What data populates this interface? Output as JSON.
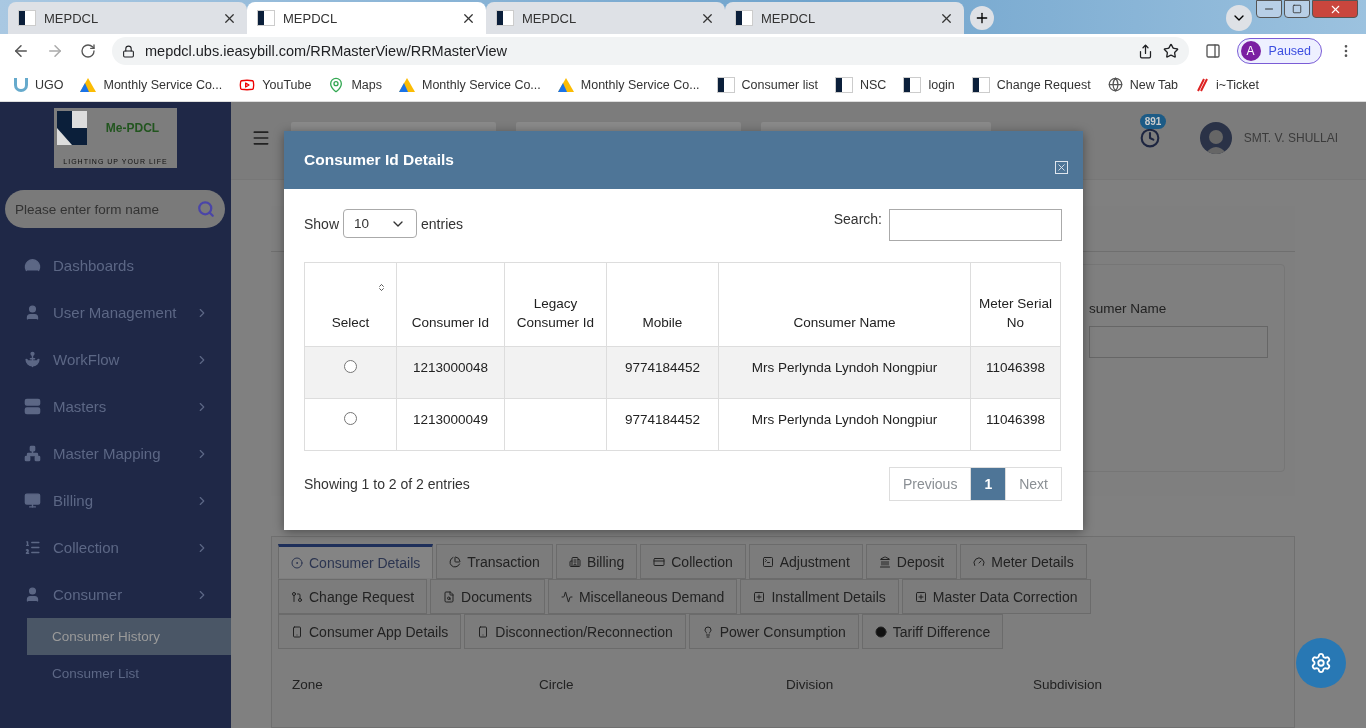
{
  "browser": {
    "tabs": [
      {
        "title": "MEPDCL",
        "selected": false
      },
      {
        "title": "MEPDCL",
        "selected": true
      },
      {
        "title": "MEPDCL",
        "selected": false
      },
      {
        "title": "MEPDCL",
        "selected": false
      }
    ],
    "address": "mepdcl.ubs.ieasybill.com/RRMasterView/RRMasterView",
    "profile": {
      "initial": "A",
      "status": "Paused"
    },
    "bookmarks": [
      "UGO",
      "Monthly Service Co...",
      "YouTube",
      "Maps",
      "Monthly Service Co...",
      "Monthly Service Co...",
      "Consumer list",
      "NSC",
      "login",
      "Change Request",
      "New Tab",
      "i~Ticket"
    ]
  },
  "sidebar": {
    "logo": {
      "name": "Me-PDCL",
      "tagline": "LIGHTING UP YOUR LIFE"
    },
    "search": {
      "placeholder": "Please enter form name"
    },
    "items": [
      {
        "label": "Dashboards",
        "has_submenu": false,
        "expanded": false
      },
      {
        "label": "User Management",
        "has_submenu": true,
        "expanded": false
      },
      {
        "label": "WorkFlow",
        "has_submenu": true,
        "expanded": false
      },
      {
        "label": "Masters",
        "has_submenu": true,
        "expanded": false
      },
      {
        "label": "Master Mapping",
        "has_submenu": true,
        "expanded": false
      },
      {
        "label": "Billing",
        "has_submenu": true,
        "expanded": false
      },
      {
        "label": "Collection",
        "has_submenu": true,
        "expanded": false
      },
      {
        "label": "Consumer",
        "has_submenu": true,
        "expanded": true,
        "children": [
          {
            "label": "Consumer History",
            "selected": true
          },
          {
            "label": "Consumer List",
            "selected": false
          }
        ]
      }
    ]
  },
  "header": {
    "notification_count": "891",
    "user": "SMT. V. SHULLAI"
  },
  "form": {
    "visible_label": "sumer Name"
  },
  "detail_tabs": [
    {
      "label": "Consumer Details",
      "selected": true
    },
    {
      "label": "Transaction",
      "selected": false
    },
    {
      "label": "Billing",
      "selected": false
    },
    {
      "label": "Collection",
      "selected": false
    },
    {
      "label": "Adjustment",
      "selected": false
    },
    {
      "label": "Deposit",
      "selected": false
    },
    {
      "label": "Meter Details",
      "selected": false
    },
    {
      "label": "Change Request",
      "selected": false
    },
    {
      "label": "Documents",
      "selected": false
    },
    {
      "label": "Miscellaneous Demand",
      "selected": false
    },
    {
      "label": "Installment Details",
      "selected": false
    },
    {
      "label": "Master Data Correction",
      "selected": false
    },
    {
      "label": "Consumer App Details",
      "selected": false
    },
    {
      "label": "Disconnection/Reconnection",
      "selected": false
    },
    {
      "label": "Power Consumption",
      "selected": false
    },
    {
      "label": "Tariff Difference",
      "selected": false
    }
  ],
  "detail_fields": [
    "Zone",
    "Circle",
    "Division",
    "Subdivision"
  ],
  "modal": {
    "title": "Consumer Id Details",
    "show_label": "Show",
    "page_size": "10",
    "entries_label": "entries",
    "search_label": "Search:",
    "table": {
      "columns": [
        "Select",
        "Consumer Id",
        "Legacy Consumer Id",
        "Mobile",
        "Consumer Name",
        "Meter Serial No"
      ],
      "rows": [
        {
          "selected": false,
          "consumer_id": "1213000048",
          "legacy_id": "",
          "mobile": "9774184452",
          "name": "Mrs Perlynda Lyndoh Nongpiur",
          "meter": "11046398"
        },
        {
          "selected": false,
          "consumer_id": "1213000049",
          "legacy_id": "",
          "mobile": "9774184452",
          "name": "Mrs Perlynda Lyndoh Nongpiur",
          "meter": "11046398"
        }
      ]
    },
    "summary": "Showing 1 to 2 of 2 entries",
    "pagination": [
      {
        "label": "Previous",
        "selected": false
      },
      {
        "label": "1",
        "selected": true
      },
      {
        "label": "Next",
        "selected": false
      }
    ]
  }
}
